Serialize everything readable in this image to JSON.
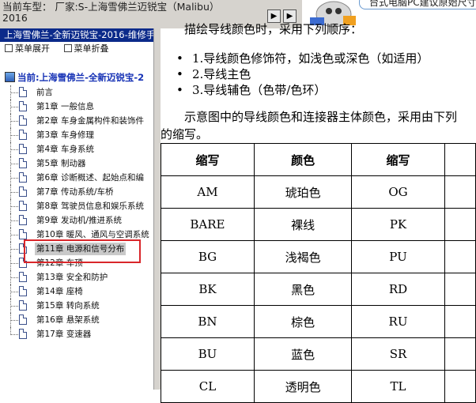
{
  "header": {
    "model_line1": "当前车型： 厂家:S-上海雪佛兰迈锐宝（Malibu）",
    "model_line2": "2016",
    "nav_prev_glyph": "▶",
    "nav_next_glyph": "▶"
  },
  "ad": {
    "text": "台式电脑PC建议原始尺寸"
  },
  "sidebar": {
    "title": "上海雪佛兰-全新迈锐宝-2016-维修手",
    "expand_label": "菜单展开",
    "collapse_label": "菜单折叠",
    "current_label": "当前:上海雪佛兰-全新迈锐宝-2",
    "items": [
      {
        "label": "前言"
      },
      {
        "label": "第1章 一般信息"
      },
      {
        "label": "第2章 车身金属构件和装饰件"
      },
      {
        "label": "第3章 车身修理"
      },
      {
        "label": "第4章 车身系统"
      },
      {
        "label": "第5章 制动器"
      },
      {
        "label": "第6章 诊断概述、起始点和编"
      },
      {
        "label": "第7章 传动系统/车桥"
      },
      {
        "label": "第8章 驾驶员信息和娱乐系统"
      },
      {
        "label": "第9章 发动机/推进系统"
      },
      {
        "label": "第10章 暖风、通风与空调系统"
      },
      {
        "label": "第11章 电源和信号分布"
      },
      {
        "label": "第12章 车顶"
      },
      {
        "label": "第13章 安全和防护"
      },
      {
        "label": "第14章 座椅"
      },
      {
        "label": "第15章 转向系统"
      },
      {
        "label": "第16章 悬架系统"
      },
      {
        "label": "第17章 变速器"
      }
    ],
    "selected_index": 11
  },
  "content": {
    "lead": "描绘导线颜色时，采用下列顺序：",
    "list": [
      "1.导线颜色修饰符，如浅色或深色（如适用）",
      "2.导线主色",
      "3.导线辅色（色带/色环）"
    ],
    "para_line1": "示意图中的导线颜色和连接器主体颜色，采用由下列",
    "para_line2": "的缩写。",
    "table": {
      "headers": [
        "缩写",
        "颜色",
        "缩写"
      ],
      "rows": [
        [
          "AM",
          "琥珀色",
          "OG"
        ],
        [
          "BARE",
          "裸线",
          "PK"
        ],
        [
          "BG",
          "浅褐色",
          "PU"
        ],
        [
          "BK",
          "黑色",
          "RD"
        ],
        [
          "BN",
          "棕色",
          "RU"
        ],
        [
          "BU",
          "蓝色",
          "SR"
        ],
        [
          "CL",
          "透明色",
          "TL"
        ]
      ]
    }
  },
  "colors": {
    "sidebar_header_bg": "#0b2a8a",
    "current_text": "#1531b5",
    "highlight_border": "#d9262a"
  }
}
